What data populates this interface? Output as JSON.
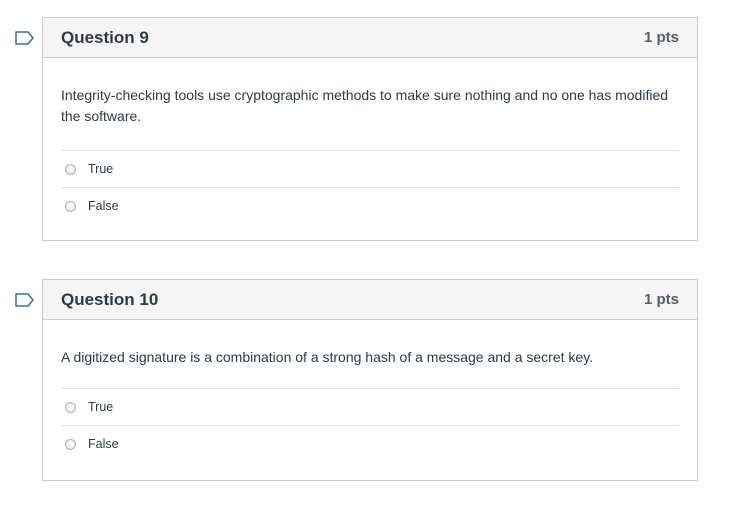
{
  "questions": [
    {
      "title": "Question 9",
      "points": "1 pts",
      "text": "Integrity-checking tools use cryptographic methods to make sure nothing and no one has modified the software.",
      "answers": [
        {
          "label": "True"
        },
        {
          "label": "False"
        }
      ]
    },
    {
      "title": "Question 10",
      "points": "1 pts",
      "text": "A digitized signature is a combination of a strong hash of a message and a secret key.",
      "answers": [
        {
          "label": "True"
        },
        {
          "label": "False"
        }
      ]
    }
  ],
  "colors": {
    "flag_outline": "#2d6fb5",
    "header_bg": "#f5f5f5",
    "border": "#c7cdd1"
  },
  "icons": {
    "flag": "flag-outline-icon",
    "radio": "radio-unchecked-icon"
  }
}
